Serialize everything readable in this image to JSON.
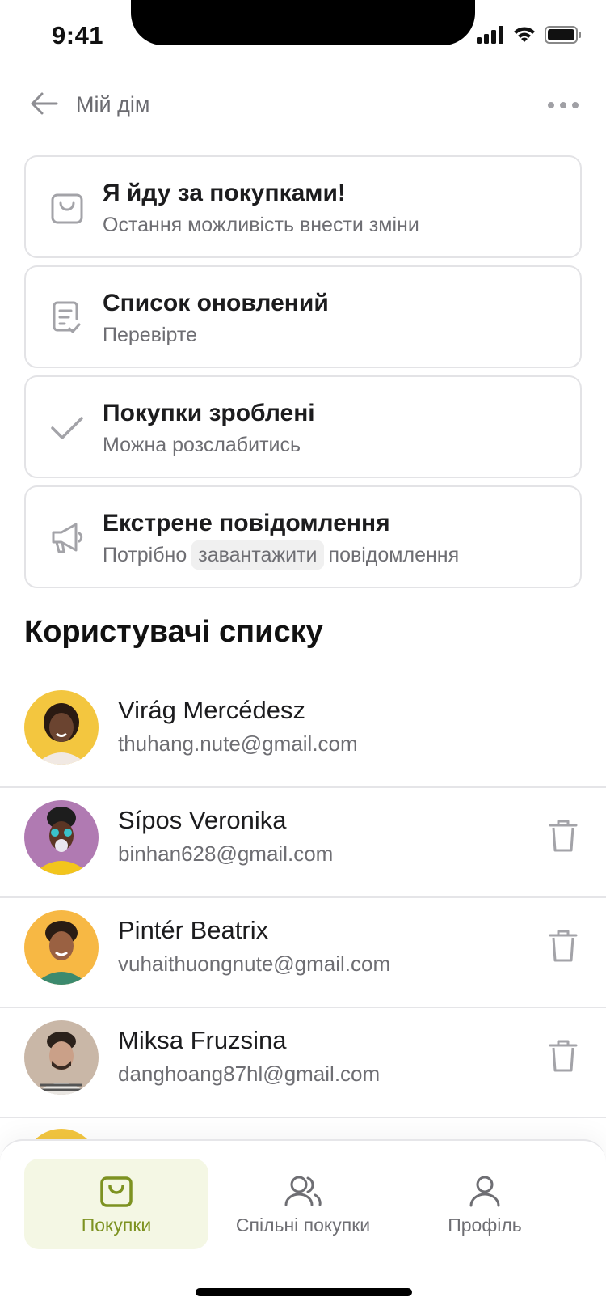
{
  "status_bar": {
    "time": "9:41"
  },
  "header": {
    "back_label": "",
    "title": "Мій дім"
  },
  "cards": [
    {
      "icon": "shopping-bag-icon",
      "title": "Я йду за покупками!",
      "subtitle": "Остання можливість внести зміни"
    },
    {
      "icon": "checklist-icon",
      "title": "Список оновлений",
      "subtitle": "Перевірте"
    },
    {
      "icon": "check-icon",
      "title": "Покупки зроблені",
      "subtitle": "Можна розслабитись"
    },
    {
      "icon": "megaphone-icon",
      "title": "Екстрене повідомлення",
      "subtitle_before": "Потрібно",
      "subtitle_chip": "завантажити",
      "subtitle_after": "повідомлення"
    }
  ],
  "users_section": {
    "title": "Користувачі списку",
    "users": [
      {
        "name": "Virág Mercédesz",
        "email": "thuhang.nute@gmail.com",
        "avatar_bg": "#f3c63f",
        "removable": false
      },
      {
        "name": "Sípos Veronika",
        "email": "binhan628@gmail.com",
        "avatar_bg": "#b07ab2",
        "removable": true
      },
      {
        "name": "Pintér Beatrix",
        "email": "vuhaithuongnute@gmail.com",
        "avatar_bg": "#f7b844",
        "removable": true
      },
      {
        "name": "Miksa Fruzsina",
        "email": "danghoang87hl@gmail.com",
        "avatar_bg": "#c9b7a7",
        "removable": true
      }
    ]
  },
  "tabbar": {
    "tabs": [
      {
        "label": "Покупки",
        "icon": "shopping-bag-icon",
        "active": true
      },
      {
        "label": "Спільні покупки",
        "icon": "users-icon",
        "active": false
      },
      {
        "label": "Профіль",
        "icon": "user-icon",
        "active": false
      }
    ]
  },
  "colors": {
    "accent": "#7d9221",
    "accent_bg": "#f4f7e4",
    "border": "#e3e3e6",
    "muted_text": "#6e6e73"
  }
}
